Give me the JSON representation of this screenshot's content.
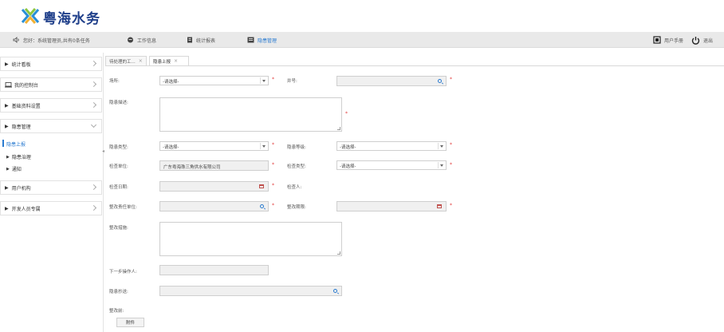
{
  "brand": {
    "title": "粤海水务"
  },
  "toolbar": {
    "greeting": "您好：系统管理员,共有0条任务",
    "work_info": "工作信息",
    "stats": "统计报表",
    "hazard_mgmt": "隐患管理",
    "manual": "用户手册",
    "logout": "退出"
  },
  "sidebar": {
    "items": [
      {
        "label": "统计看板"
      },
      {
        "label": "我的控制台"
      },
      {
        "label": "基础资料设置"
      },
      {
        "label": "隐患管理"
      },
      {
        "label": "用户机构"
      },
      {
        "label": "开发人员专属"
      }
    ],
    "sub_items": [
      {
        "label": "隐患上报"
      },
      {
        "label": "隐患治理"
      },
      {
        "label": "通知"
      }
    ]
  },
  "tabs": [
    {
      "label": "待处理的工..."
    },
    {
      "label": "隐患上报"
    }
  ],
  "form": {
    "site_label": "场所:",
    "site_value": "-请选择-",
    "well_label": "井号:",
    "desc_label": "隐患描述:",
    "type_label": "隐患类型:",
    "type_value": "-请选择-",
    "level_label": "隐患等级:",
    "level_value": "-请选择-",
    "unit_label": "检查单位:",
    "unit_value": "广东粤海珠三角供水有限公司",
    "check_type_label": "检查类型:",
    "check_type_value": "-请选择-",
    "date_label": "检查日期:",
    "inspector_label": "检查人:",
    "resp_unit_label": "整改责任单位:",
    "deadline_label": "整改期限:",
    "measures_label": "整改措施:",
    "next_label": "下一步操作人:",
    "cc_label": "隐患抄送:",
    "before_label": "整改前:",
    "attach_button": "附件"
  }
}
